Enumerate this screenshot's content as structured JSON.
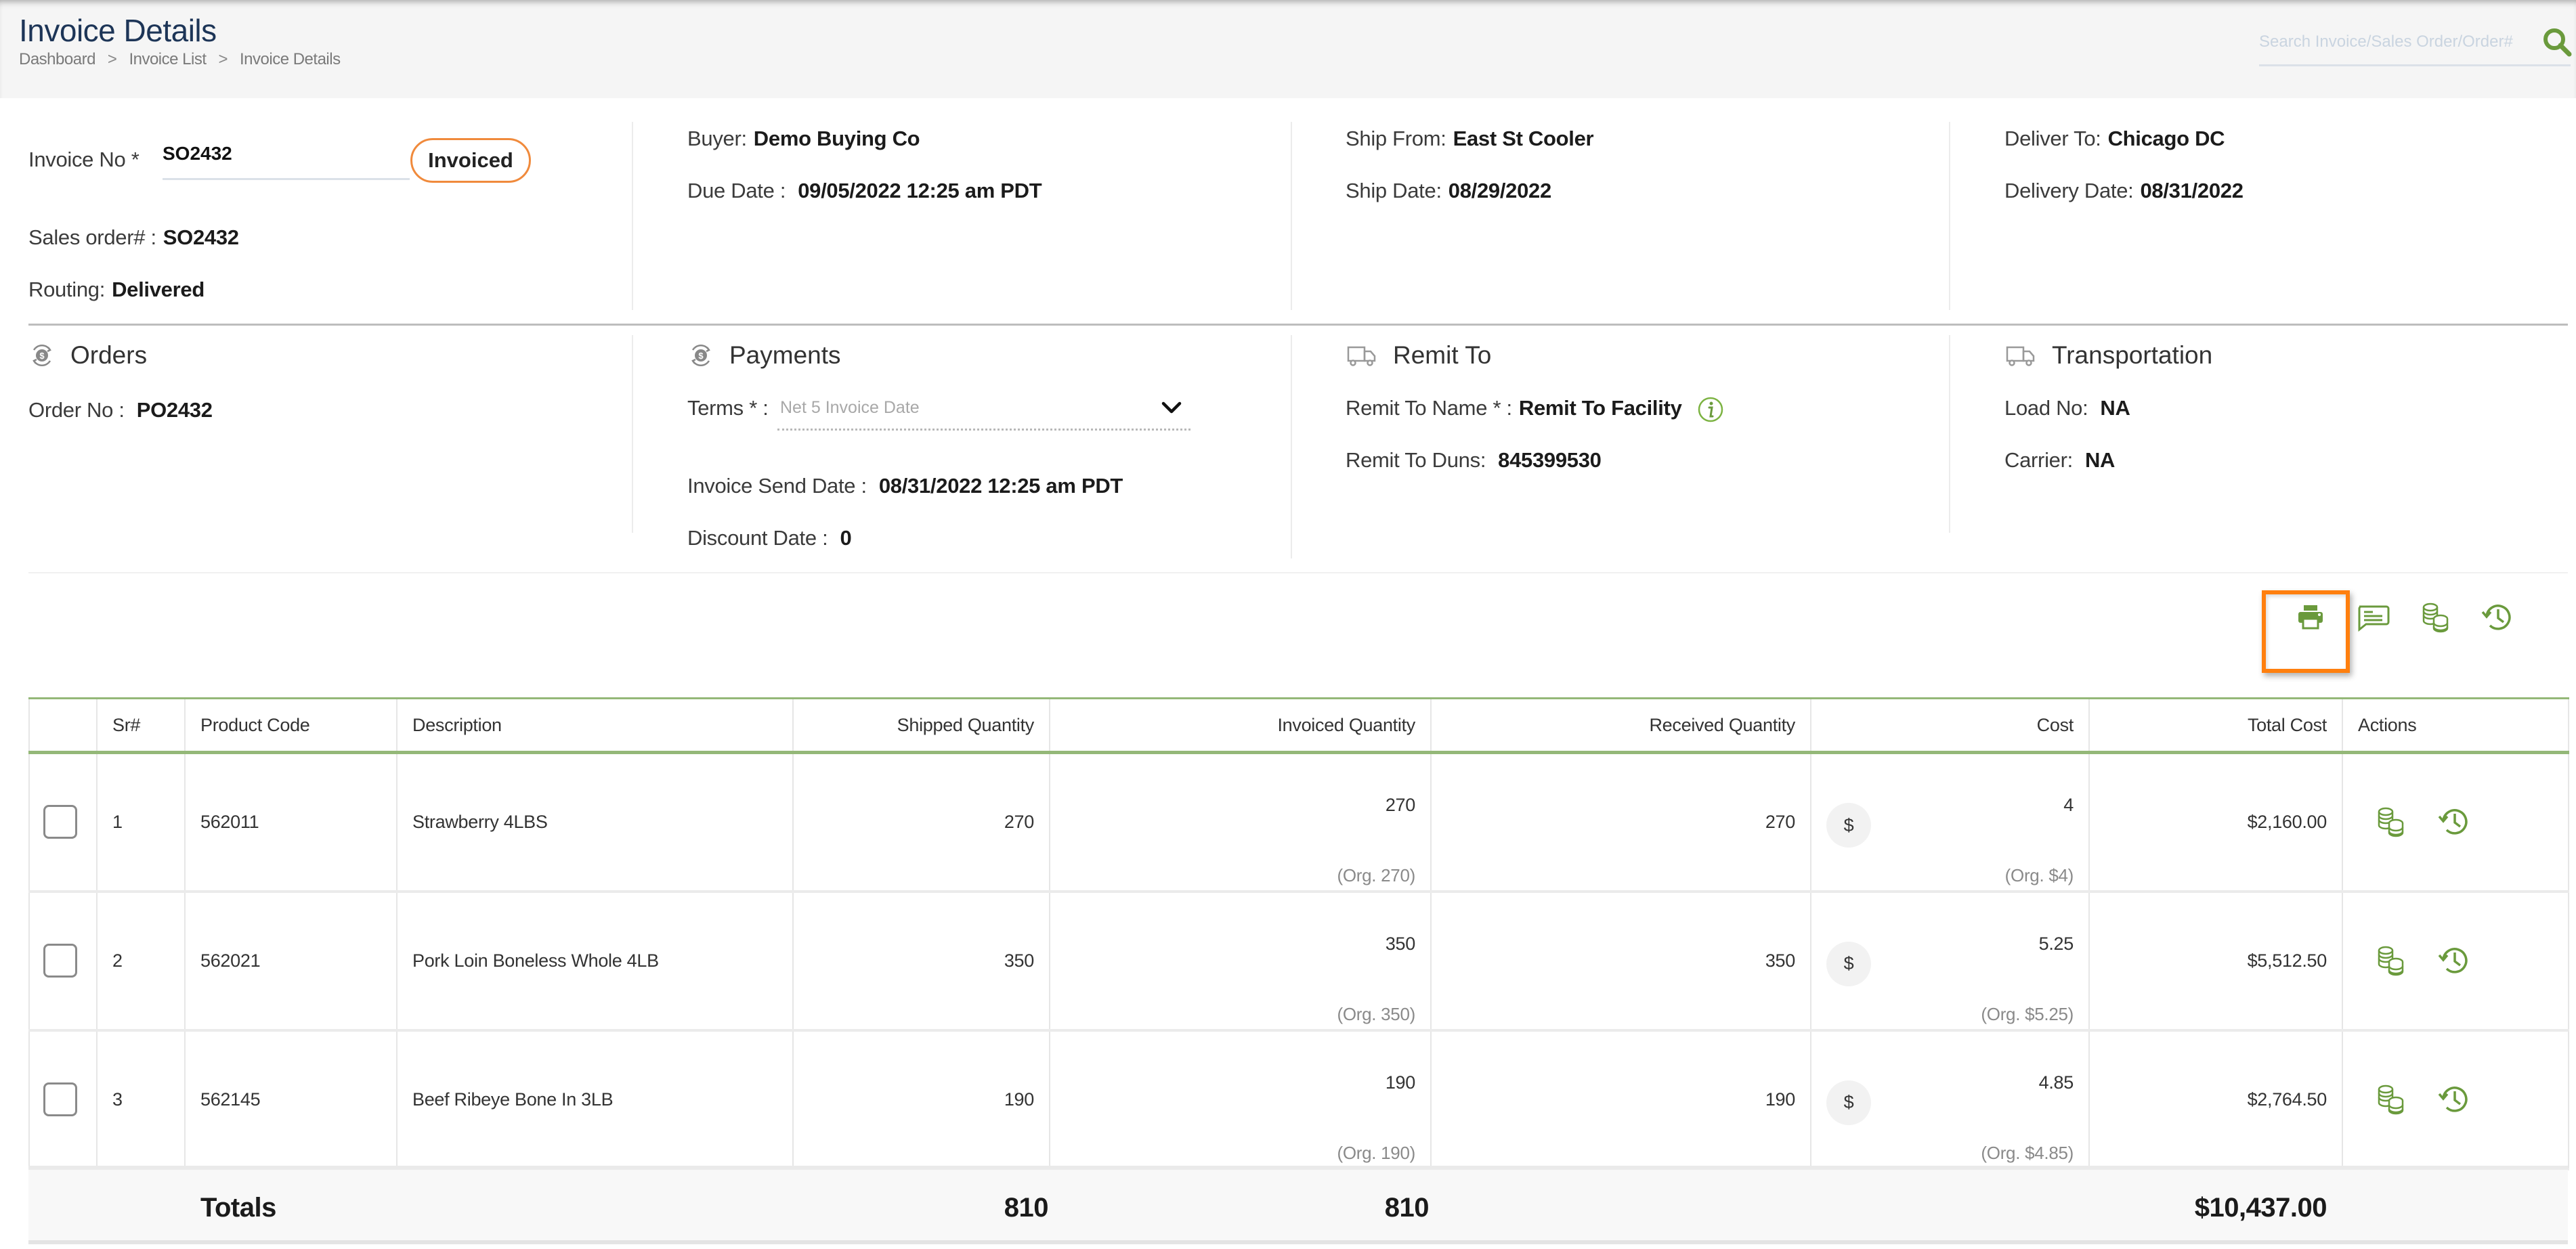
{
  "header": {
    "title": "Invoice Details",
    "breadcrumb": [
      "Dashboard",
      "Invoice List",
      "Invoice Details"
    ],
    "breadcrumb_separator": ">",
    "search_placeholder": "Search Invoice/Sales Order/Order#",
    "search_icon": "search-icon"
  },
  "summary": {
    "invoice_no_label": "Invoice No *",
    "invoice_no_value": "SO2432",
    "status": "Invoiced",
    "sales_order_label": "Sales order# :",
    "sales_order_value": "SO2432",
    "routing_label": "Routing:",
    "routing_value": "Delivered",
    "buyer_label": "Buyer:",
    "buyer_value": "Demo Buying Co",
    "due_date_label": "Due Date :",
    "due_date_value": "09/05/2022 12:25 am PDT",
    "ship_from_label": "Ship From:",
    "ship_from_value": "East St Cooler",
    "ship_date_label": "Ship Date:",
    "ship_date_value": "08/29/2022",
    "deliver_to_label": "Deliver To:",
    "deliver_to_value": "Chicago DC",
    "delivery_date_label": "Delivery Date:",
    "delivery_date_value": "08/31/2022"
  },
  "orders": {
    "title": "Orders",
    "icon": "dollar-exchange-icon",
    "order_no_label": "Order No :",
    "order_no_value": "PO2432"
  },
  "payments": {
    "title": "Payments",
    "icon": "dollar-exchange-icon",
    "terms_label": "Terms * :",
    "terms_value": "Net 5 Invoice Date",
    "invoice_send_date_label": "Invoice Send Date :",
    "invoice_send_date_value": "08/31/2022 12:25 am PDT",
    "discount_date_label": "Discount Date :",
    "discount_date_value": "0"
  },
  "remit_to": {
    "title": "Remit To",
    "icon": "truck-icon",
    "name_label": "Remit To Name * :",
    "name_value": "Remit To Facility",
    "duns_label": "Remit To Duns:",
    "duns_value": "845399530"
  },
  "transportation": {
    "title": "Transportation",
    "icon": "truck-icon",
    "load_no_label": "Load No:",
    "load_no_value": "NA",
    "carrier_label": "Carrier:",
    "carrier_value": "NA"
  },
  "toolbar": {
    "icons": [
      "print-icon",
      "comment-icon",
      "coins-icon",
      "history-icon"
    ]
  },
  "table": {
    "columns": [
      "",
      "Sr#",
      "Product Code",
      "Description",
      "Shipped Quantity",
      "Invoiced Quantity",
      "Received Quantity",
      "Cost",
      "Total Cost",
      "Actions"
    ],
    "rows": [
      {
        "sr": "1",
        "product_code": "562011",
        "description": "Strawberry 4LBS",
        "shipped_qty": "270",
        "invoiced_qty": "270",
        "invoiced_org": "(Org. 270)",
        "received_qty": "270",
        "currency": "$",
        "cost": "4",
        "cost_org": "(Org. $4)",
        "total_cost": "$2,160.00"
      },
      {
        "sr": "2",
        "product_code": "562021",
        "description": "Pork Loin Boneless Whole 4LB",
        "shipped_qty": "350",
        "invoiced_qty": "350",
        "invoiced_org": "(Org. 350)",
        "received_qty": "350",
        "currency": "$",
        "cost": "5.25",
        "cost_org": "(Org. $5.25)",
        "total_cost": "$5,512.50"
      },
      {
        "sr": "3",
        "product_code": "562145",
        "description": "Beef Ribeye Bone In 3LB",
        "shipped_qty": "190",
        "invoiced_qty": "190",
        "invoiced_org": "(Org. 190)",
        "received_qty": "190",
        "currency": "$",
        "cost": "4.85",
        "cost_org": "(Org. $4.85)",
        "total_cost": "$2,764.50"
      }
    ],
    "totals": {
      "label": "Totals",
      "shipped_qty": "810",
      "invoiced_qty": "810",
      "total_cost": "$10,437.00"
    }
  },
  "colors": {
    "accent_green": "#6a9a3c",
    "status_orange": "#f08a3c",
    "highlight_orange": "#ff7f0e",
    "title_navy": "#1d3557"
  }
}
